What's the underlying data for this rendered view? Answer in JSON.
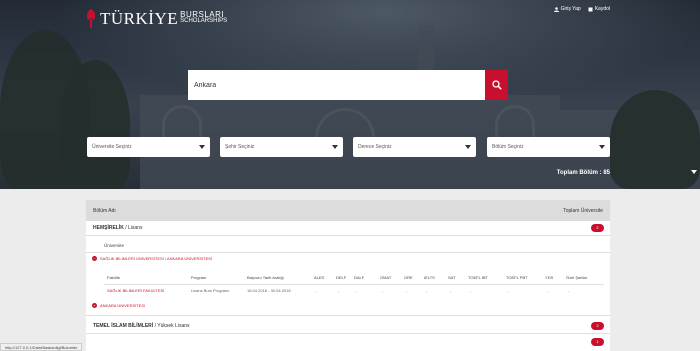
{
  "brand": {
    "name": "TÜRKİYE",
    "sub1": "BURSLARI",
    "sub2": "SCHOLARSHIPS"
  },
  "toplinks": {
    "login": "Giriş Yap",
    "register": "Kaydol"
  },
  "search": {
    "value": "Ankara"
  },
  "filters": [
    {
      "label": "Üniversite Seçiniz"
    },
    {
      "label": "Şehir Seçiniz"
    },
    {
      "label": "Derece Seçiniz"
    },
    {
      "label": "Bölüm Seçiniz"
    }
  ],
  "total_label": "Toplam Bölüm : 85",
  "panel": {
    "col_left": "Bölüm Adı",
    "col_right": "Toplam Üniversite",
    "rows": [
      {
        "title": "HEMŞİRELİK",
        "suffix": " / Lisans",
        "count": "2"
      },
      {
        "title": "TEMEL İSLAM BİLİMLERİ",
        "suffix": " / Yüksek Lisans",
        "count": "2"
      },
      {
        "title": "",
        "suffix": "",
        "count": "1"
      }
    ],
    "university_label": "Üniversite",
    "university_1": "SAĞLIK BİLİMLERİ ÜNİVERSİTESİ / ANKARA ÜNİVERSİTESİ",
    "university_2": "ANKARA ÜNİVERSİTESİ",
    "table_headers": [
      "Fakülte",
      "Program",
      "Başvuru Tarih Aralığı",
      "ALES",
      "DELF",
      "DALF",
      "GMAT",
      "GRE",
      "IELTS",
      "SAT",
      "TOEFL IBT",
      "TOEFL PBT",
      "YDS",
      "Özel Şartlar"
    ],
    "table_row": [
      "SAĞLIK BİLİMLERİ FAKÜLTESİ",
      "Lisans Burs Programı",
      "16.04.2018 - 30.04.2018",
      "-",
      "-",
      "-",
      "-",
      "-",
      "-",
      "-",
      "-",
      "-",
      "-",
      "-"
    ]
  },
  "status_bar": "http://127.0.0.1/DaireBaskanligi/Bolumler",
  "colors": {
    "accent": "#c8102e",
    "panel_head": "#dcdcdc"
  }
}
